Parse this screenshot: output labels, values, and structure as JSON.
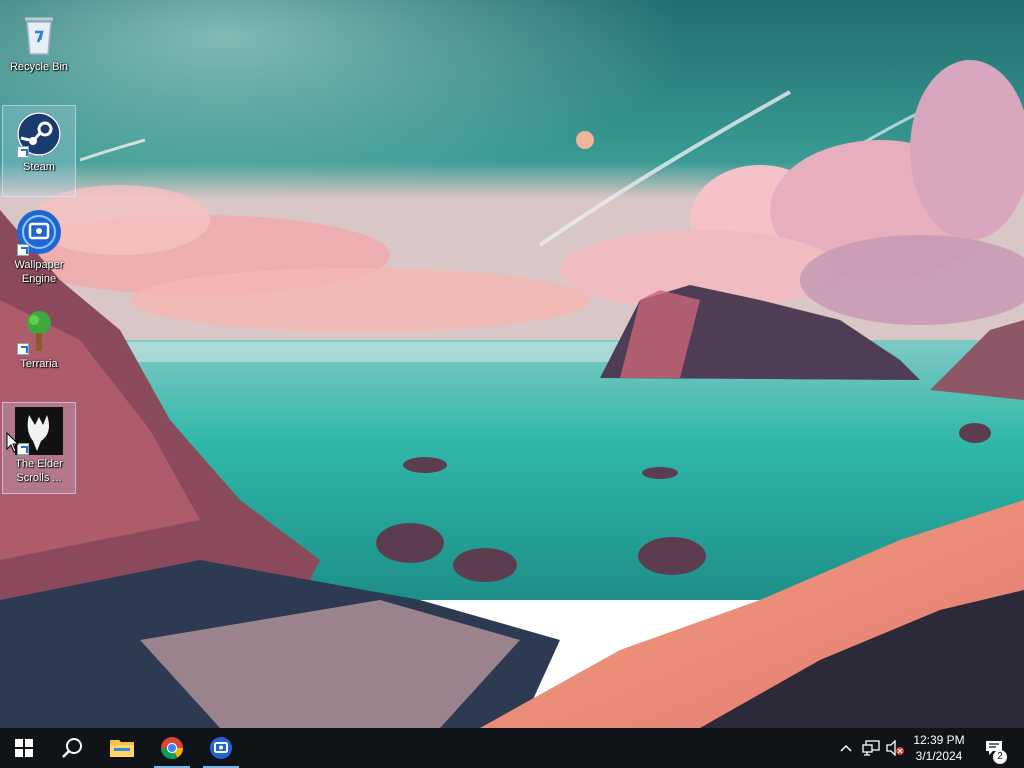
{
  "desktop": {
    "icons": [
      {
        "label": "Recycle Bin",
        "icon": "recycle-bin-icon"
      },
      {
        "label": "Steam",
        "icon": "steam-icon"
      },
      {
        "label": "Wallpaper Engine",
        "icon": "wallpaper-engine-icon"
      },
      {
        "label": "Terraria",
        "icon": "terraria-icon"
      },
      {
        "label": "The Elder Scrolls ...",
        "icon": "elder-scrolls-icon"
      }
    ],
    "wallpaper": "coastal-sunset-wallpaper"
  },
  "taskbar": {
    "start": {
      "icon": "windows-logo-icon"
    },
    "search": {
      "icon": "search-icon"
    },
    "pinned": [
      {
        "name": "File Explorer",
        "icon": "folder-icon",
        "active": false
      },
      {
        "name": "Google Chrome",
        "icon": "chrome-icon",
        "active": true
      },
      {
        "name": "Wallpaper Engine",
        "icon": "wallpaper-engine-icon",
        "active": true
      }
    ],
    "tray": {
      "icons": [
        "chevron-up-icon",
        "network-icon",
        "volume-muted-icon"
      ],
      "time": "12:39 PM",
      "date": "3/1/2024",
      "notification_count": "2"
    }
  },
  "colors": {
    "taskbar": "#101318",
    "active_indicator": "#76b9ed",
    "sea": "#2fb7a8",
    "sky": "#2e7e7a",
    "clouds": "#f2a7ad"
  }
}
